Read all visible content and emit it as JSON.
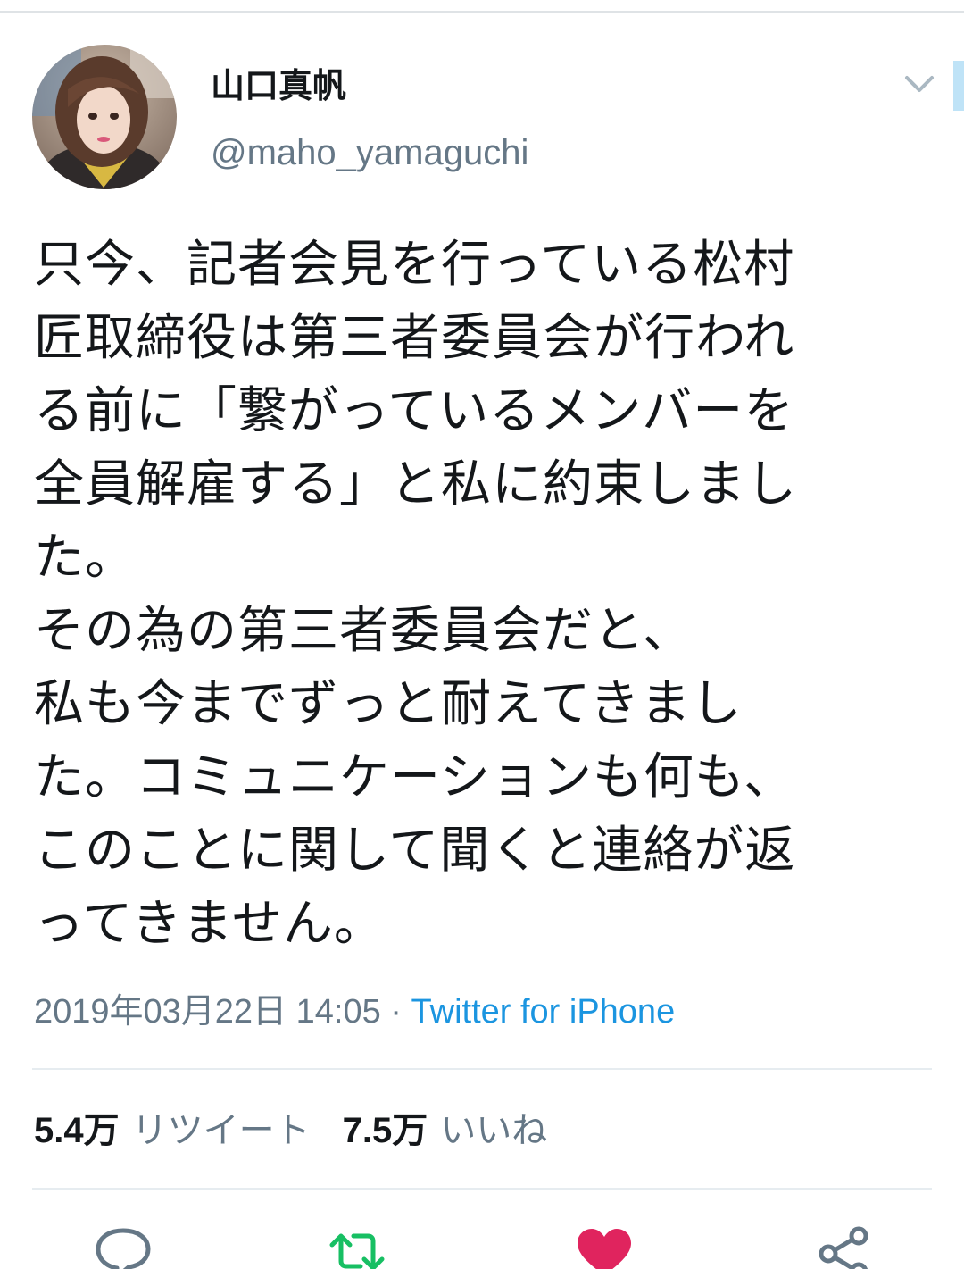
{
  "tweet": {
    "author": {
      "display_name": "山口真帆",
      "handle": "@maho_yamaguchi"
    },
    "text": "只今、記者会見を行っている松村\n匠取締役は第三者委員会が行われ\nる前に「繋がっているメンバーを\n全員解雇する」と私に約束しまし\nた。\nその為の第三者委員会だと、\n私も今までずっと耐えてきまし\nた。コミュニケーションも何も、\nこのことに関して聞くと連絡が返\nってきません。",
    "timestamp": "2019年03月22日 14:05",
    "separator": " · ",
    "source": "Twitter for iPhone",
    "stats": {
      "retweet_count": "5.4万",
      "retweet_label": "リツイート",
      "like_count": "7.5万",
      "like_label": "いいね"
    }
  },
  "icons": {
    "menu": "chevron-down-icon",
    "reply": "reply-icon",
    "retweet": "retweet-icon",
    "like": "heart-icon",
    "share": "share-icon"
  },
  "colors": {
    "text": "#14171a",
    "secondary": "#657786",
    "link": "#1b95e0",
    "retweet_green": "#17bf63",
    "like_red": "#e0245e",
    "icon_gray": "#657786",
    "divider": "#e6ecf0"
  }
}
